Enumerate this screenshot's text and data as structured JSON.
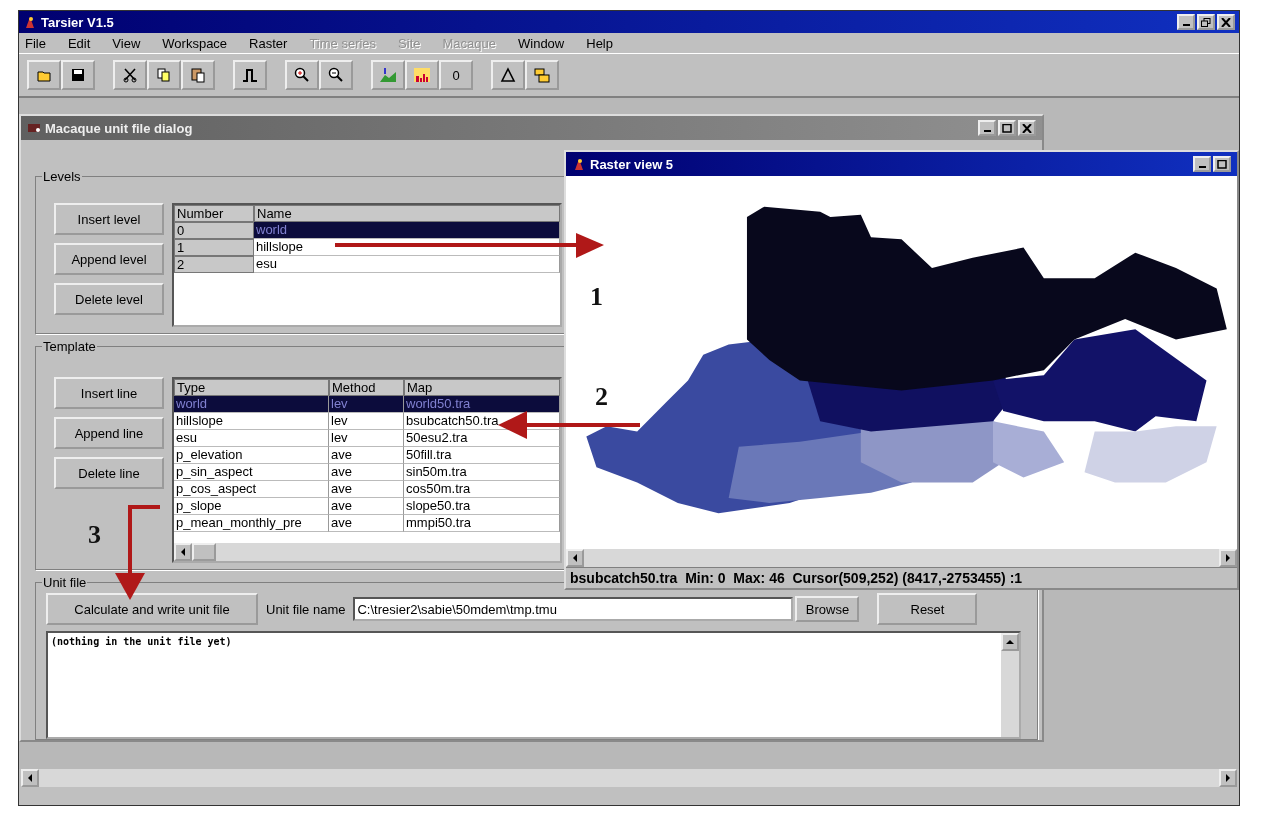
{
  "window": {
    "title": "Tarsier V1.5"
  },
  "menu": [
    {
      "label": "File",
      "disabled": false
    },
    {
      "label": "Edit",
      "disabled": false
    },
    {
      "label": "View",
      "disabled": false
    },
    {
      "label": "Workspace",
      "disabled": false
    },
    {
      "label": "Raster",
      "disabled": false
    },
    {
      "label": "Time series",
      "disabled": true
    },
    {
      "label": "Site",
      "disabled": true
    },
    {
      "label": "Macaque",
      "disabled": true
    },
    {
      "label": "Window",
      "disabled": false
    },
    {
      "label": "Help",
      "disabled": false
    }
  ],
  "toolbar": {
    "counter_button": "0"
  },
  "dialog": {
    "title": "Macaque unit file dialog",
    "levels": {
      "title": "Levels",
      "buttons": [
        "Insert level",
        "Append level",
        "Delete level"
      ],
      "columns": [
        "Number",
        "Name"
      ],
      "rows": [
        {
          "cells": [
            "0",
            "world"
          ],
          "selected": true
        },
        {
          "cells": [
            "1",
            "hillslope"
          ],
          "selected": false
        },
        {
          "cells": [
            "2",
            "esu"
          ],
          "selected": false
        }
      ]
    },
    "template": {
      "title": "Template",
      "buttons": [
        "Insert line",
        "Append line",
        "Delete line"
      ],
      "columns": [
        "Type",
        "Method",
        "Map"
      ],
      "rows": [
        {
          "cells": [
            "world",
            "lev",
            "world50.tra"
          ],
          "selected": true
        },
        {
          "cells": [
            "hillslope",
            "lev",
            "bsubcatch50.tra"
          ],
          "selected": false
        },
        {
          "cells": [
            "esu",
            "lev",
            "50esu2.tra"
          ],
          "selected": false
        },
        {
          "cells": [
            "p_elevation",
            "ave",
            "50fill.tra"
          ],
          "selected": false
        },
        {
          "cells": [
            "p_sin_aspect",
            "ave",
            "sin50m.tra"
          ],
          "selected": false
        },
        {
          "cells": [
            "p_cos_aspect",
            "ave",
            "cos50m.tra"
          ],
          "selected": false
        },
        {
          "cells": [
            "p_slope",
            "ave",
            "slope50.tra"
          ],
          "selected": false
        },
        {
          "cells": [
            "p_mean_monthly_pre",
            "ave",
            "mmpi50.tra"
          ],
          "selected": false
        }
      ]
    },
    "unit_file": {
      "title": "Unit file",
      "calculate_button": "Calculate and write unit file",
      "name_label": "Unit file name",
      "name_value": "C:\\tresier2\\sabie\\50mdem\\tmp.tmu",
      "browse_button": "Browse",
      "reset_button": "Reset",
      "output": "(nothing in the unit file yet)"
    }
  },
  "raster_view": {
    "title": "Raster view 5",
    "status": "bsubcatch50.tra  Min: 0  Max: 46  Cursor(509,252) (8417,-2753455) :1"
  },
  "annotations": [
    {
      "label": "1"
    },
    {
      "label": "2"
    },
    {
      "label": "3"
    }
  ]
}
